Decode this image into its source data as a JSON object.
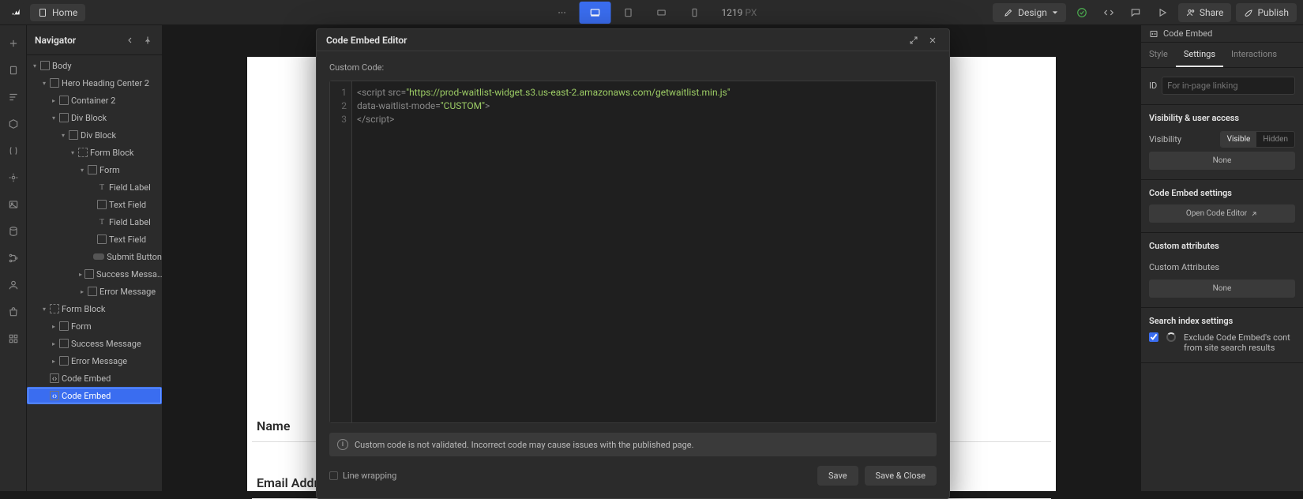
{
  "toolbar": {
    "home": "Home",
    "width": "1219",
    "unit": "PX",
    "design": "Design",
    "share": "Share",
    "publish": "Publish"
  },
  "navigator": {
    "title": "Navigator",
    "tree": [
      {
        "indent": 0,
        "toggle": "down",
        "icon": "box",
        "label": "Body"
      },
      {
        "indent": 1,
        "toggle": "down",
        "icon": "box",
        "label": "Hero Heading Center 2"
      },
      {
        "indent": 2,
        "toggle": "right",
        "icon": "box",
        "label": "Container 2"
      },
      {
        "indent": 2,
        "toggle": "down",
        "icon": "box",
        "label": "Div Block"
      },
      {
        "indent": 3,
        "toggle": "down",
        "icon": "box",
        "label": "Div Block"
      },
      {
        "indent": 4,
        "toggle": "down",
        "icon": "form",
        "label": "Form Block"
      },
      {
        "indent": 5,
        "toggle": "down",
        "icon": "box",
        "label": "Form"
      },
      {
        "indent": 6,
        "toggle": "none",
        "icon": "T",
        "label": "Field Label"
      },
      {
        "indent": 6,
        "toggle": "none",
        "icon": "box",
        "label": "Text Field"
      },
      {
        "indent": 6,
        "toggle": "none",
        "icon": "T",
        "label": "Field Label"
      },
      {
        "indent": 6,
        "toggle": "none",
        "icon": "box",
        "label": "Text Field"
      },
      {
        "indent": 6,
        "toggle": "none",
        "icon": "btn",
        "label": "Submit Button"
      },
      {
        "indent": 5,
        "toggle": "right",
        "icon": "box",
        "label": "Success Messa…"
      },
      {
        "indent": 5,
        "toggle": "right",
        "icon": "box",
        "label": "Error Message"
      },
      {
        "indent": 1,
        "toggle": "down",
        "icon": "form",
        "label": "Form Block"
      },
      {
        "indent": 2,
        "toggle": "right",
        "icon": "box",
        "label": "Form"
      },
      {
        "indent": 2,
        "toggle": "right",
        "icon": "box",
        "label": "Success Message"
      },
      {
        "indent": 2,
        "toggle": "right",
        "icon": "box",
        "label": "Error Message"
      },
      {
        "indent": 1,
        "toggle": "none",
        "icon": "embed",
        "label": "Code Embed"
      },
      {
        "indent": 1,
        "toggle": "none",
        "icon": "embed",
        "label": "Code Embed",
        "selected": true
      }
    ]
  },
  "canvas": {
    "field_name": "Name",
    "field_email": "Email Address"
  },
  "modal": {
    "title": "Code Embed Editor",
    "label": "Custom Code:",
    "lines": [
      "1",
      "2",
      "3"
    ],
    "code_line1_a": "<script ",
    "code_line1_b": "src=",
    "code_line1_c": "\"https://prod-waitlist-widget.s3.us-east-2.amazonaws.com/getwaitlist.min.js\"",
    "code_line2_a": "data-waitlist-mode=",
    "code_line2_b": "\"CUSTOM\"",
    "code_line2_c": ">",
    "code_line3": "</script>",
    "warning": "Custom code is not validated. Incorrect code may cause issues with the published page.",
    "linewrap": "Line wrapping",
    "save": "Save",
    "saveclose": "Save & Close"
  },
  "right": {
    "header": "Code Embed",
    "tabs": {
      "style": "Style",
      "settings": "Settings",
      "interactions": "Interactions"
    },
    "id_label": "ID",
    "id_placeholder": "For in-page linking",
    "visibility_title": "Visibility & user access",
    "visibility_label": "Visibility",
    "visible": "Visible",
    "hidden": "Hidden",
    "none": "None",
    "settings_title": "Code Embed settings",
    "open_editor": "Open Code Editor",
    "custom_attr_title": "Custom attributes",
    "custom_attr_label": "Custom Attributes",
    "search_title": "Search index settings",
    "search_desc1": "Exclude Code Embed's cont",
    "search_desc2": "from site search results"
  }
}
